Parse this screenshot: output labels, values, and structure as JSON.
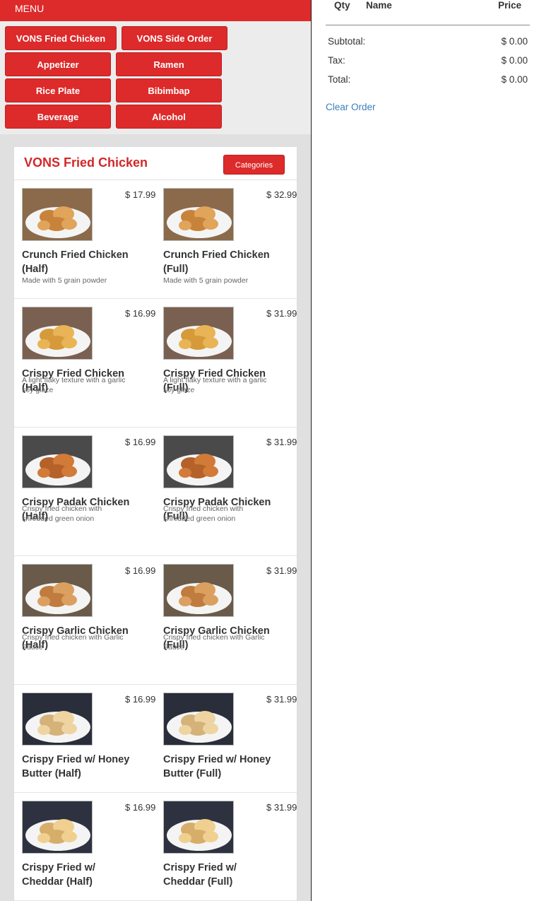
{
  "menu": {
    "header": "MENU",
    "categories": [
      "VONS Fried Chicken",
      "VONS Side Order",
      "Appetizer",
      "Ramen",
      "Rice Plate",
      "Bibimbap",
      "Beverage",
      "Alcohol"
    ]
  },
  "section": {
    "title": "VONS Fried Chicken",
    "categories_button": "Categories"
  },
  "items": [
    {
      "name": "Crunch Fried Chicken (Half)",
      "price": "$ 17.99",
      "desc": "Made with 5 grain powder"
    },
    {
      "name": "Crunch Fried Chicken (Full)",
      "price": "$ 32.99",
      "desc": "Made with 5 grain powder"
    },
    {
      "name": "Crispy Fried Chicken (Half)",
      "price": "$ 16.99",
      "desc": "A light flaky texture with a garlic soy glaze"
    },
    {
      "name": "Crispy Fried Chicken (Full)",
      "price": "$ 31.99",
      "desc": "A light flaky texture with a garlic soy glaze"
    },
    {
      "name": "Crispy Padak Chicken (Half)",
      "price": "$ 16.99",
      "desc": "Crispy fried chicken with shredded green onion"
    },
    {
      "name": "Crispy Padak Chicken (Full)",
      "price": "$ 31.99",
      "desc": "Crispy fried chicken with shredded green onion"
    },
    {
      "name": "Crispy Garlic Chicken (Half)",
      "price": "$ 16.99",
      "desc": "Crispy fried chicken with Garlic Sauce"
    },
    {
      "name": "Crispy Garlic Chicken (Full)",
      "price": "$ 31.99",
      "desc": "Crispy fried chicken with Garlic Sauce"
    },
    {
      "name": "Crispy Fried w/ Honey Butter (Half)",
      "price": "$ 16.99",
      "desc": ""
    },
    {
      "name": "Crispy Fried w/ Honey Butter (Full)",
      "price": "$ 31.99",
      "desc": ""
    },
    {
      "name": "Crispy Fried w/ Cheddar (Half)",
      "price": "$ 16.99",
      "desc": ""
    },
    {
      "name": "Crispy Fried w/ Cheddar (Full)",
      "price": "$ 31.99",
      "desc": ""
    }
  ],
  "order": {
    "col_qty": "Qty",
    "col_name": "Name",
    "col_price": "Price",
    "subtotal_label": "Subtotal:",
    "subtotal_value": "$ 0.00",
    "tax_label": "Tax:",
    "tax_value": "$ 0.00",
    "total_label": "Total:",
    "total_value": "$ 0.00",
    "clear_label": "Clear Order"
  },
  "colors": {
    "accent": "#dd2a2a",
    "link": "#3a7fba"
  }
}
